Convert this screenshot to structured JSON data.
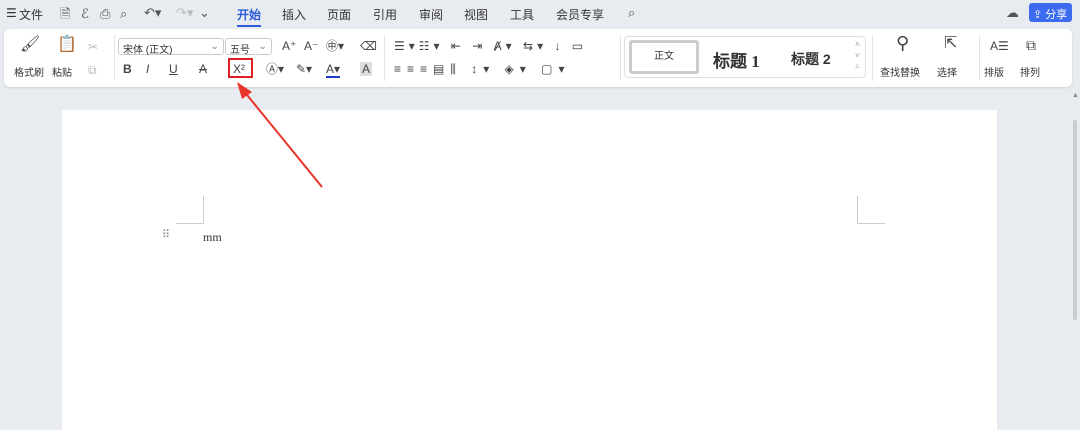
{
  "menu": {
    "hamburger": "☰",
    "file": "文件",
    "tabs": [
      "开始",
      "插入",
      "页面",
      "引用",
      "审阅",
      "视图",
      "工具",
      "会员专享"
    ],
    "active_tab": "开始",
    "share": "分享"
  },
  "ribbon": {
    "format_painter": "格式刷",
    "paste": "粘贴",
    "font_name": "宋体 (正文)",
    "font_size": "五号",
    "styles": {
      "normal": "正文",
      "h1": "标题 1",
      "h2": "标题 2"
    },
    "find_replace": "查找替换",
    "select": "选择",
    "layout": "排版",
    "arrange": "排列",
    "bold": "B",
    "italic": "I",
    "underline": "U",
    "strike": "A",
    "superscript": "X²",
    "grow": "A⁺",
    "shrink": "A⁻"
  },
  "document": {
    "text": "mm"
  },
  "colors": {
    "accent": "#2b5bd7",
    "highlight_box": "#e02020",
    "arrow": "#e8352b"
  }
}
